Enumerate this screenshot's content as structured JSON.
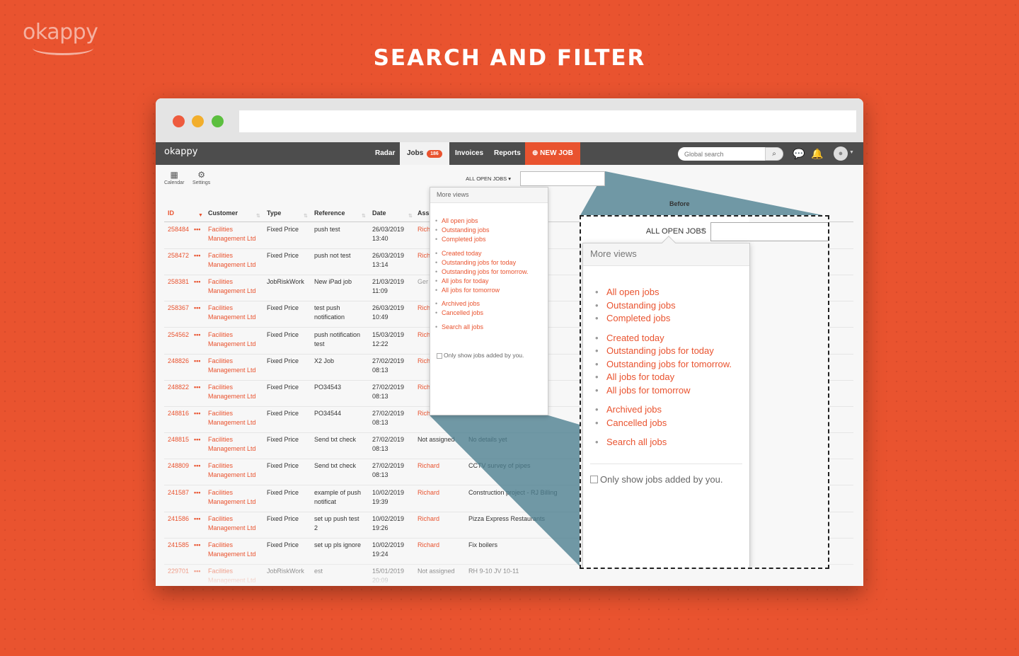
{
  "brand": {
    "logo": "okappy"
  },
  "heading": "SEARCH AND FILTER",
  "nav": {
    "logo": "okappy",
    "radar": "Radar",
    "jobs": "Jobs",
    "jobs_count": "186",
    "invoices": "Invoices",
    "reports": "Reports",
    "new_job": "NEW JOB",
    "global_search_placeholder": "Global search"
  },
  "toolbar": {
    "calendar": "Calendar",
    "settings": "Settings"
  },
  "table": {
    "headers": {
      "id": "ID",
      "customer": "Customer",
      "type": "Type",
      "reference": "Reference",
      "date": "Date",
      "assigned": "Ass",
      "before": "Before"
    },
    "rows": [
      {
        "id": "258484",
        "cust1": "Facilities",
        "cust2": "Management Ltd",
        "type": "Fixed Price",
        "ref1": "push test",
        "ref2": "",
        "date1": "26/03/2019",
        "date2": "13:40",
        "assigned": "Rich",
        "details": ""
      },
      {
        "id": "258472",
        "cust1": "Facilities",
        "cust2": "Management Ltd",
        "type": "Fixed Price",
        "ref1": "push not test",
        "ref2": "",
        "date1": "26/03/2019",
        "date2": "13:14",
        "assigned": "Rich",
        "details": ""
      },
      {
        "id": "258381",
        "cust1": "Facilities",
        "cust2": "Management Ltd",
        "type": "JobRiskWork",
        "ref1": "New iPad job",
        "ref2": "",
        "date1": "21/03/2019",
        "date2": "11:09",
        "assigned": "Ger",
        "details": ""
      },
      {
        "id": "258367",
        "cust1": "Facilities",
        "cust2": "Management Ltd",
        "type": "Fixed Price",
        "ref1": "test push",
        "ref2": "notification",
        "date1": "26/03/2019",
        "date2": "10:49",
        "assigned": "Rich",
        "details": ""
      },
      {
        "id": "254562",
        "cust1": "Facilities",
        "cust2": "Management Ltd",
        "type": "Fixed Price",
        "ref1": "push notification",
        "ref2": "test",
        "date1": "15/03/2019",
        "date2": "12:22",
        "assigned": "Rich",
        "details": ""
      },
      {
        "id": "248826",
        "cust1": "Facilities",
        "cust2": "Management Ltd",
        "type": "Fixed Price",
        "ref1": "X2 Job",
        "ref2": "",
        "date1": "27/02/2019",
        "date2": "08:13",
        "assigned": "Rich",
        "details": ""
      },
      {
        "id": "248822",
        "cust1": "Facilities",
        "cust2": "Management Ltd",
        "type": "Fixed Price",
        "ref1": "PO34543",
        "ref2": "",
        "date1": "27/02/2019",
        "date2": "08:13",
        "assigned": "Rich",
        "details": ""
      },
      {
        "id": "248816",
        "cust1": "Facilities",
        "cust2": "Management Ltd",
        "type": "Fixed Price",
        "ref1": "PO34544",
        "ref2": "",
        "date1": "27/02/2019",
        "date2": "08:13",
        "assigned": "Rich",
        "details": ""
      },
      {
        "id": "248815",
        "cust1": "Facilities",
        "cust2": "Management Ltd",
        "type": "Fixed Price",
        "ref1": "Send txt check",
        "ref2": "",
        "date1": "27/02/2019",
        "date2": "08:13",
        "assigned": "Not assigned",
        "details": "No details yet"
      },
      {
        "id": "248809",
        "cust1": "Facilities",
        "cust2": "Management Ltd",
        "type": "Fixed Price",
        "ref1": "Send txt check",
        "ref2": "",
        "date1": "27/02/2019",
        "date2": "08:13",
        "assigned": "Richard",
        "details": "CCTV survey of pipes"
      },
      {
        "id": "241587",
        "cust1": "Facilities",
        "cust2": "Management Ltd",
        "type": "Fixed Price",
        "ref1": "example of push",
        "ref2": "notificat",
        "date1": "10/02/2019",
        "date2": "19:39",
        "assigned": "Richard",
        "details": "Construction project - RJ Billing"
      },
      {
        "id": "241586",
        "cust1": "Facilities",
        "cust2": "Management Ltd",
        "type": "Fixed Price",
        "ref1": "set up push test",
        "ref2": "2",
        "date1": "10/02/2019",
        "date2": "19:26",
        "assigned": "Richard",
        "details": "Pizza Express Restaurants"
      },
      {
        "id": "241585",
        "cust1": "Facilities",
        "cust2": "Management Ltd",
        "type": "Fixed Price",
        "ref1": "set up pls ignore",
        "ref2": "",
        "date1": "10/02/2019",
        "date2": "19:24",
        "assigned": "Richard",
        "details": "Fix boilers"
      },
      {
        "id": "229701",
        "cust1": "Facilities",
        "cust2": "Management Ltd",
        "type": "JobRiskWork",
        "ref1": "est",
        "ref2": "",
        "date1": "15/01/2019",
        "date2": "20:09",
        "assigned": "Not assigned",
        "details": "RH 9-10 JV 10-11"
      }
    ]
  },
  "views": {
    "trigger": "ALL OPEN JOBS",
    "header": "More views",
    "group1": [
      "All open jobs",
      "Outstanding jobs",
      "Completed jobs"
    ],
    "group2": [
      "Created today",
      "Outstanding jobs for today",
      "Outstanding jobs for tomorrow.",
      "All jobs for today",
      "All jobs for tomorrow"
    ],
    "group3": [
      "Archived jobs",
      "Cancelled jobs"
    ],
    "group4": [
      "Search all jobs"
    ],
    "only_mine": "Only show jobs added by you."
  },
  "colors": {
    "brand": "#e9532f",
    "nav": "#4d4d4d",
    "projection": "#4e7f90"
  }
}
